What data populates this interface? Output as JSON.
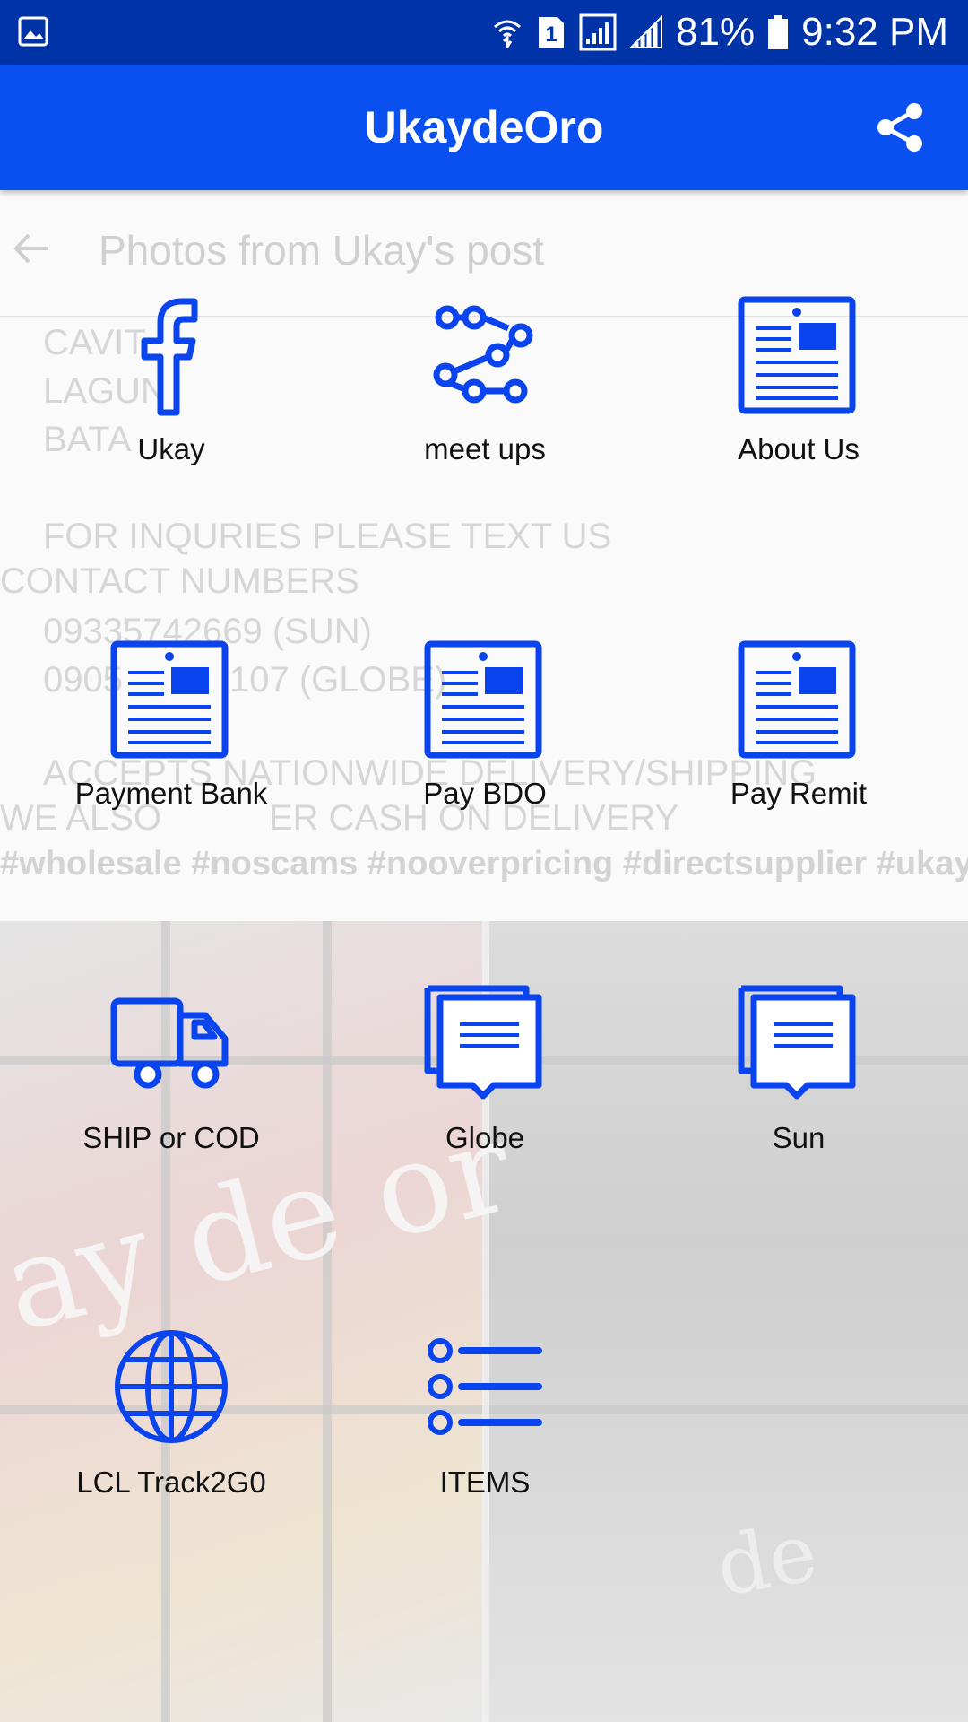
{
  "status_bar": {
    "battery": "81%",
    "time": "9:32 PM",
    "sim_slot": "1"
  },
  "app_bar": {
    "title": "UkaydeOro"
  },
  "background": {
    "post_title": "Photos from Ukay's post",
    "lines": [
      "CAVIT",
      "LAGUN",
      "BATA",
      "FOR INQURIES PLEASE TEXT US",
      "CONTACT NUMBERS",
      "09335742669 (SUN)",
      "0905",
      "107 (GLOBE)",
      "ACCEPTS NATIONWIDE DELIVERY/SHIPPING",
      "WE ALSO",
      "ER CASH ON DELIVERY"
    ],
    "hashtags": "#wholesale #noscams #nooverpricing #directsupplier #ukay",
    "photo_text": "ay de or",
    "photo_text_2": "de"
  },
  "tiles": [
    {
      "label": "Ukay",
      "icon": "facebook-icon"
    },
    {
      "label": "meet ups",
      "icon": "route-icon"
    },
    {
      "label": "About Us",
      "icon": "news-article-icon"
    },
    {
      "label": "Payment Bank",
      "icon": "news-article-icon"
    },
    {
      "label": "Pay BDO",
      "icon": "news-article-icon"
    },
    {
      "label": "Pay Remit",
      "icon": "news-article-icon"
    },
    {
      "label": "SHIP or COD",
      "icon": "truck-icon"
    },
    {
      "label": "Globe",
      "icon": "chat-messages-icon"
    },
    {
      "label": "Sun",
      "icon": "chat-messages-icon"
    },
    {
      "label": "LCL Track2G0",
      "icon": "globe-icon"
    },
    {
      "label": "ITEMS",
      "icon": "list-icon"
    }
  ],
  "colors": {
    "status_bar": "#0033a8",
    "app_bar": "#0a4ff0",
    "icon": "#0a44ee"
  }
}
